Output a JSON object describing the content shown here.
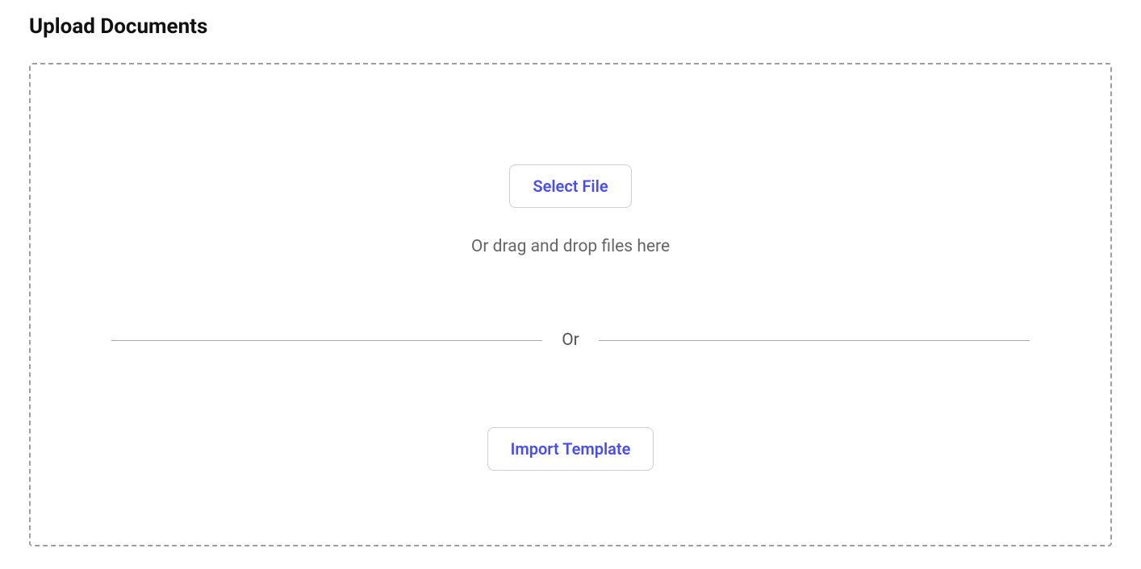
{
  "title": "Upload Documents",
  "dropzone": {
    "select_file_label": "Select File",
    "drag_hint": "Or drag and drop files here",
    "divider_label": "Or",
    "import_template_label": "Import Template"
  }
}
